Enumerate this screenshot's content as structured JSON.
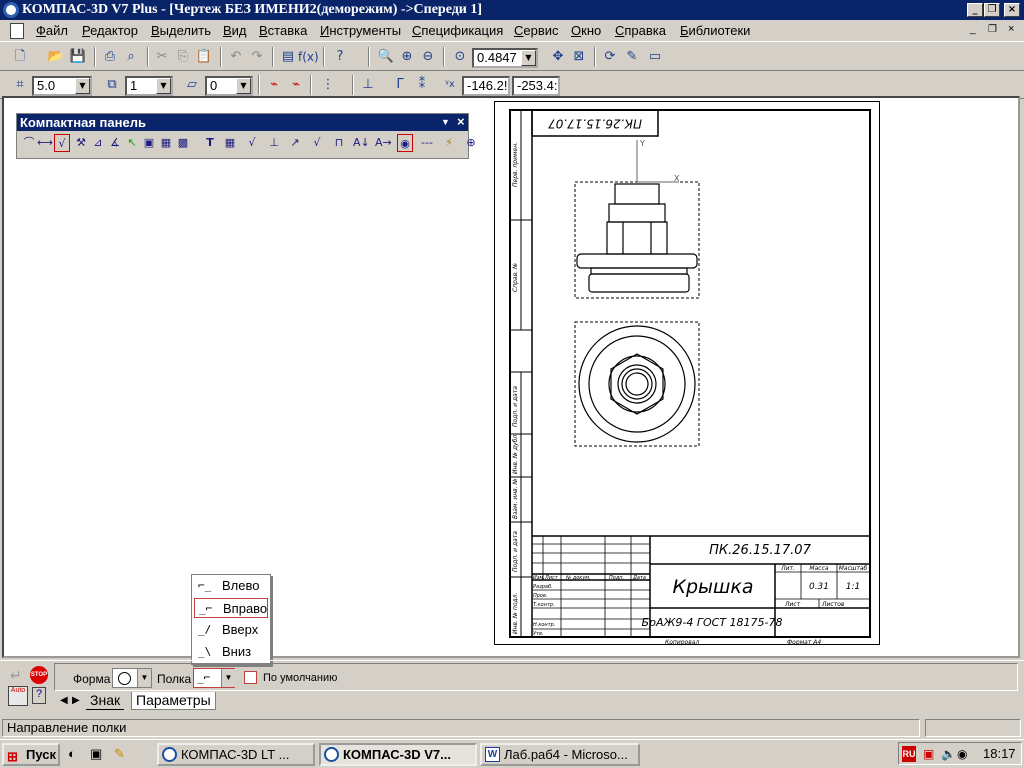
{
  "title": "КОМПАС-3D V7 Plus - [Чертеж БЕЗ ИМЕНИ2(деморежим) ->Спереди 1]",
  "menu": [
    "Файл",
    "Редактор",
    "Выделить",
    "Вид",
    "Вставка",
    "Инструменты",
    "Спецификация",
    "Сервис",
    "Окно",
    "Справка",
    "Библиотеки"
  ],
  "toolbar": {
    "zoom_value": "0.4847",
    "step_value": "5.0",
    "layer_value": "1",
    "style_value": "0",
    "coord_x": "-146.2!",
    "coord_y": "-253.4:"
  },
  "compact_panel": {
    "title": "Компактная панель"
  },
  "drawing": {
    "doc_code": "ПК.26.15.17.07",
    "doc_code_rotated": "ПК.26.15.17.07",
    "part_name": "Крышка",
    "material": "БрАЖ9-4  ГОСТ 18175-78",
    "scale_value": "1:1",
    "mass_value": "0.31",
    "hdr_lit": "Лит.",
    "hdr_mass": "Масса",
    "hdr_scale": "Масштаб",
    "hdr_sheet": "Лист",
    "hdr_sheets": "Листов",
    "row_izm": "Изм.",
    "row_list": "Лист",
    "row_ndoc": "№ докум.",
    "row_podp": "Подп.",
    "row_data": "Дата",
    "role_razrab": "Разраб.",
    "role_prov": "Пров.",
    "role_tkontr": "Т.контр.",
    "role_nkontr": "Н.контр.",
    "role_utv": "Утв.",
    "copied": "Копировал",
    "format": "Формат   А4",
    "side_labels": [
      "Перв. примен.",
      "Справ. №",
      "Подп. и дата",
      "Инв. № дубл.",
      "Взам. инв. №",
      "Подп. и дата",
      "Инв. № подл."
    ]
  },
  "dropdown": {
    "items": [
      "Влево",
      "Вправо",
      "Вверх",
      "Вниз"
    ],
    "selected": "Вправо"
  },
  "properties": {
    "forma_label": "Форма",
    "polka_label": "Полка",
    "default_label": "По умолчанию",
    "tabs": [
      "Знак",
      "Параметры"
    ]
  },
  "status_text": "Направление полки",
  "taskbar": {
    "start": "Пуск",
    "tasks": [
      "КОМПАС-3D LT ...",
      "КОМПАС-3D V7...",
      "Лаб.раб4 - Microso..."
    ],
    "clock": "18:17"
  }
}
